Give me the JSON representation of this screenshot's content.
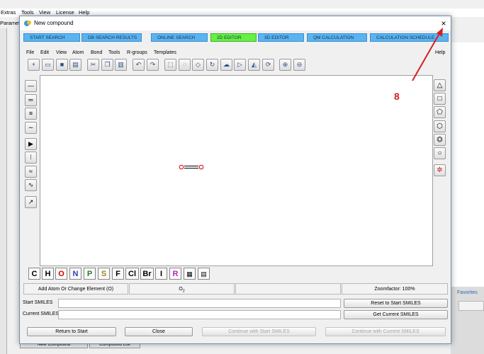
{
  "background_app": {
    "menu": [
      "Extras",
      "Tools",
      "View",
      "License",
      "Help"
    ],
    "params_label": "Paramet",
    "favorites_label": "Favorites",
    "bottom_tabs": [
      "New Compound",
      "Compound List"
    ]
  },
  "dialog": {
    "title": "New compound",
    "close_glyph": "×",
    "tabs": [
      {
        "label": "START SEARCH",
        "active": false
      },
      {
        "label": "DB SEARCH RESULTS",
        "active": false
      },
      {
        "label": "ONLINE SEARCH",
        "active": false
      },
      {
        "label": "2D EDITOR",
        "active": true
      },
      {
        "label": "3D EDITOR",
        "active": false
      },
      {
        "label": "QM CALCULATION",
        "active": false
      },
      {
        "label": "CALCULATION SCHEDULE",
        "active": false
      }
    ],
    "menu": [
      "File",
      "Edit",
      "View",
      "Atom",
      "Bond",
      "Tools",
      "R-groups",
      "Templates"
    ],
    "help": "Help",
    "toolbar_icons": [
      "new-icon",
      "open-icon",
      "save-icon",
      "print-icon",
      "cut-icon",
      "copy-icon",
      "paste-icon",
      "undo-icon",
      "redo-icon",
      "select-icon",
      "lasso-icon",
      "eraser-icon",
      "rotate-icon",
      "clean-icon",
      "flip-horizontal-icon",
      "flip-vertical-icon",
      "refresh-icon",
      "zoom-in-icon",
      "zoom-out-icon"
    ],
    "left_tools": [
      "single-bond-icon",
      "double-bond-icon",
      "triple-bond-icon",
      "any-bond-icon",
      "wedge-bond-icon",
      "hash-bond-icon",
      "wavy-bond-icon",
      "chain-icon",
      "edit-atom-icon"
    ],
    "right_tools": [
      "triangle-ring-icon",
      "square-ring-icon",
      "pentagon-ring-icon",
      "hexagon-ring-icon",
      "benzene-ring-icon",
      "circle-ring-icon",
      "template-icon"
    ],
    "molecule": {
      "atom1": "O",
      "atom2": "O",
      "bond": "double"
    },
    "elements": [
      "C",
      "H",
      "O",
      "N",
      "P",
      "S",
      "F",
      "Cl",
      "Br",
      "I",
      "R"
    ],
    "element_colors": {
      "C": "#000000",
      "H": "#000000",
      "O": "#d40000",
      "N": "#2d3fb8",
      "P": "#208020",
      "S": "#9a8a10",
      "F": "#000000",
      "Cl": "#000000",
      "Br": "#000000",
      "I": "#000000",
      "R": "#c020c0"
    },
    "status": {
      "action": "Add Atom Or Change Element (O)",
      "formula": "O",
      "formula_sub": "2",
      "empty": "",
      "zoom": "Zoomfactor: 100%"
    },
    "start_smiles_label": "Start SMILES",
    "current_smiles_label": "Current SMILES",
    "start_smiles_value": "",
    "current_smiles_value": "",
    "reset_button": "Reset to Start SMILES",
    "get_current_button": "Get Current SMILES",
    "buttons": {
      "return": "Return to Start",
      "close": "Close",
      "continue_start": "Continue with Start SMILES",
      "continue_current": "Continue with Current SMILES"
    }
  },
  "annotation": {
    "number": "8",
    "color": "#d62020"
  }
}
